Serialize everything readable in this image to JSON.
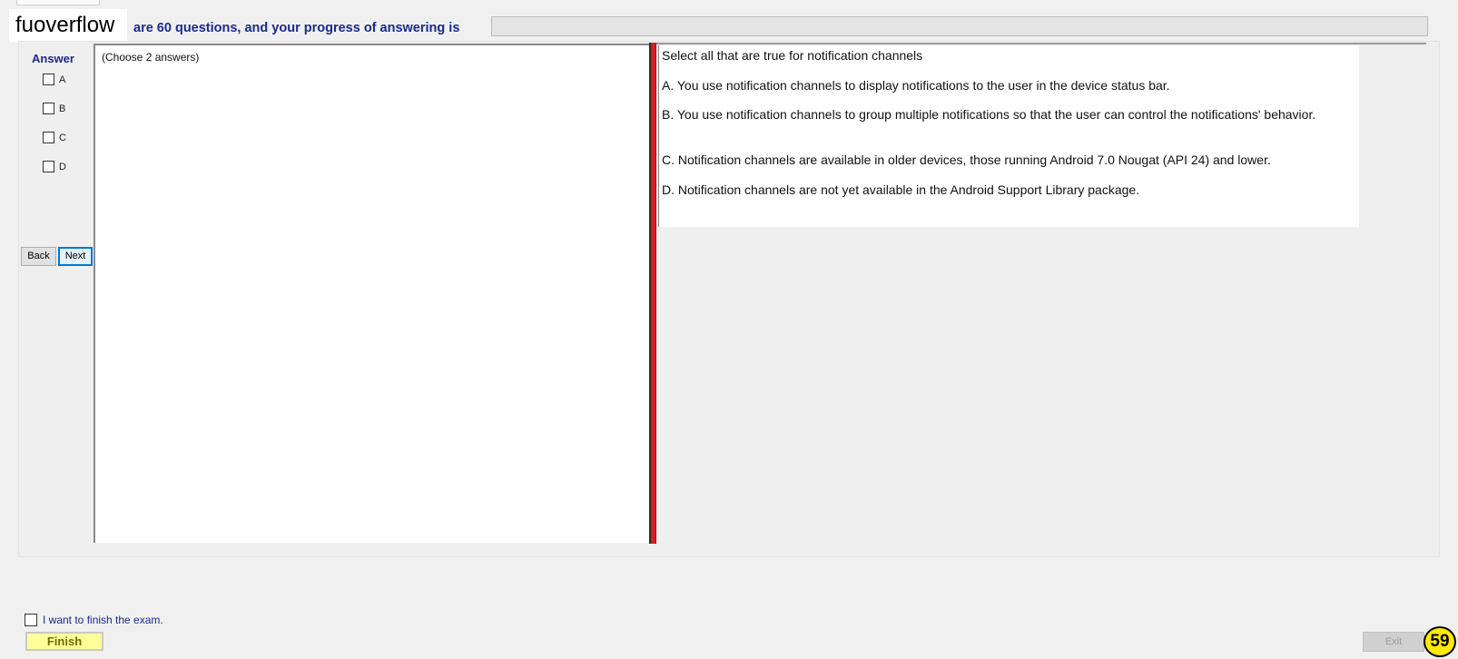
{
  "watermark": "fuoverflow",
  "header": {
    "progress_text": "are 60 questions, and your progress of answering is"
  },
  "progress": {
    "value": 0
  },
  "answer_panel": {
    "title": "Answer",
    "options": [
      "A",
      "B",
      "C",
      "D"
    ],
    "back_label": "Back",
    "next_label": "Next"
  },
  "notes": {
    "text": "(Choose 2 answers)"
  },
  "question": {
    "prompt": "Select all that are true for notification channels",
    "choices": [
      "A.  You use notification channels to display notifications to the user in the device status bar.",
      "B.  You use notification channels to group multiple notifications so that the user can control the notifications' behavior.",
      "C.  Notification channels are available in older devices, those running Android 7.0 Nougat (API 24) and lower.",
      "D.  Notification channels are not yet available in the Android Support Library package."
    ]
  },
  "footer": {
    "finish_check_label": "I want to finish the exam.",
    "finish_label": "Finish",
    "exit_label": "Exit",
    "badge": "59"
  },
  "colors": {
    "accent_text": "#1a2a8c",
    "divider": "#dd1b1b",
    "finish_bg": "#ffff99",
    "badge_bg": "#ffea00"
  }
}
